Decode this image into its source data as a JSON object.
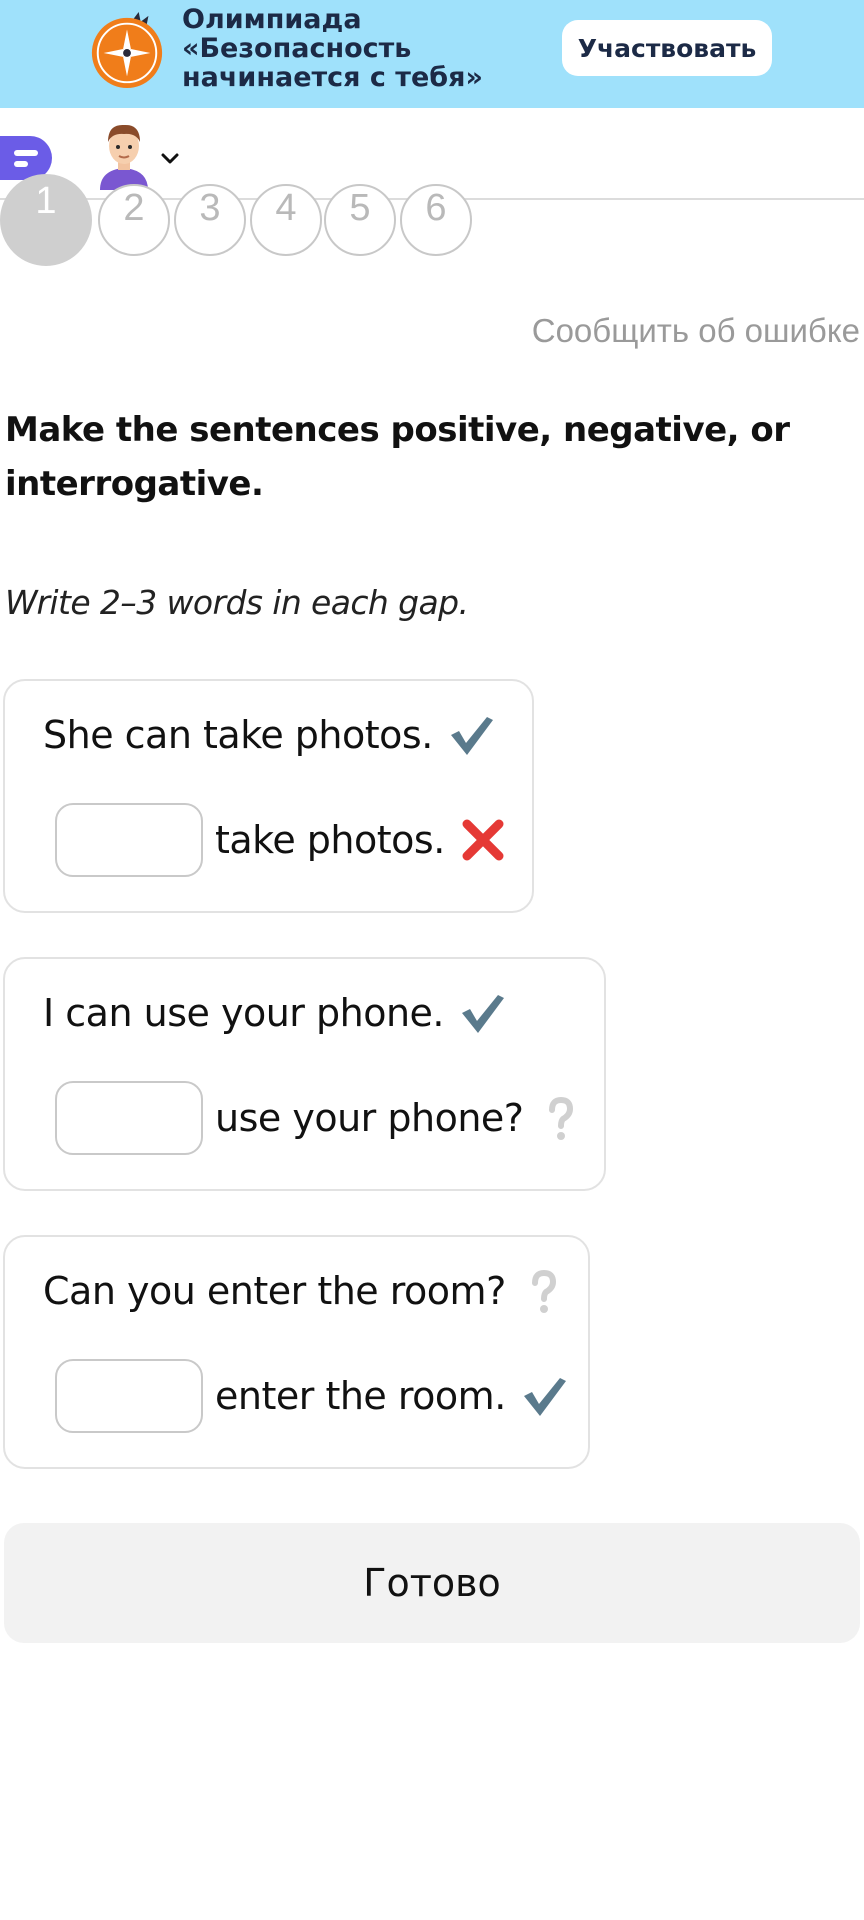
{
  "banner": {
    "title_lines": [
      "Олимпиада",
      "«Безопасность",
      "начинается с тебя»"
    ],
    "button_label": "Участвовать"
  },
  "header": {
    "chat_icon": "chat-bubble-icon",
    "avatar": "user-avatar",
    "chevron": "chevron-down-icon"
  },
  "steps": {
    "items": [
      "1",
      "2",
      "3",
      "4",
      "5",
      "6"
    ],
    "active_index": 0
  },
  "report_link": "Сообщить об ошибке",
  "task": {
    "title": "Make the sentences positive, negative, or interrogative.",
    "hint": "Write 2–3 words in each gap."
  },
  "cards": [
    {
      "sentence": "She can take photos.",
      "sentence_mark": "check-icon",
      "gap_value": "",
      "after_gap": "take photos.",
      "after_mark": "cross-icon"
    },
    {
      "sentence": "I can use your phone.",
      "sentence_mark": "check-icon",
      "gap_value": "",
      "after_gap": "use your phone?",
      "after_mark": "question-icon"
    },
    {
      "sentence": "Can you enter the room?",
      "sentence_mark": "question-icon",
      "gap_value": "",
      "after_gap": "enter the room.",
      "after_mark": "check-icon"
    }
  ],
  "done_button": "Готово",
  "colors": {
    "banner_bg": "#9fe1fb",
    "chat_icon": "#6b5ce7",
    "check": "#5a7a8c",
    "cross": "#e53935",
    "question": "#d0d0d0"
  }
}
